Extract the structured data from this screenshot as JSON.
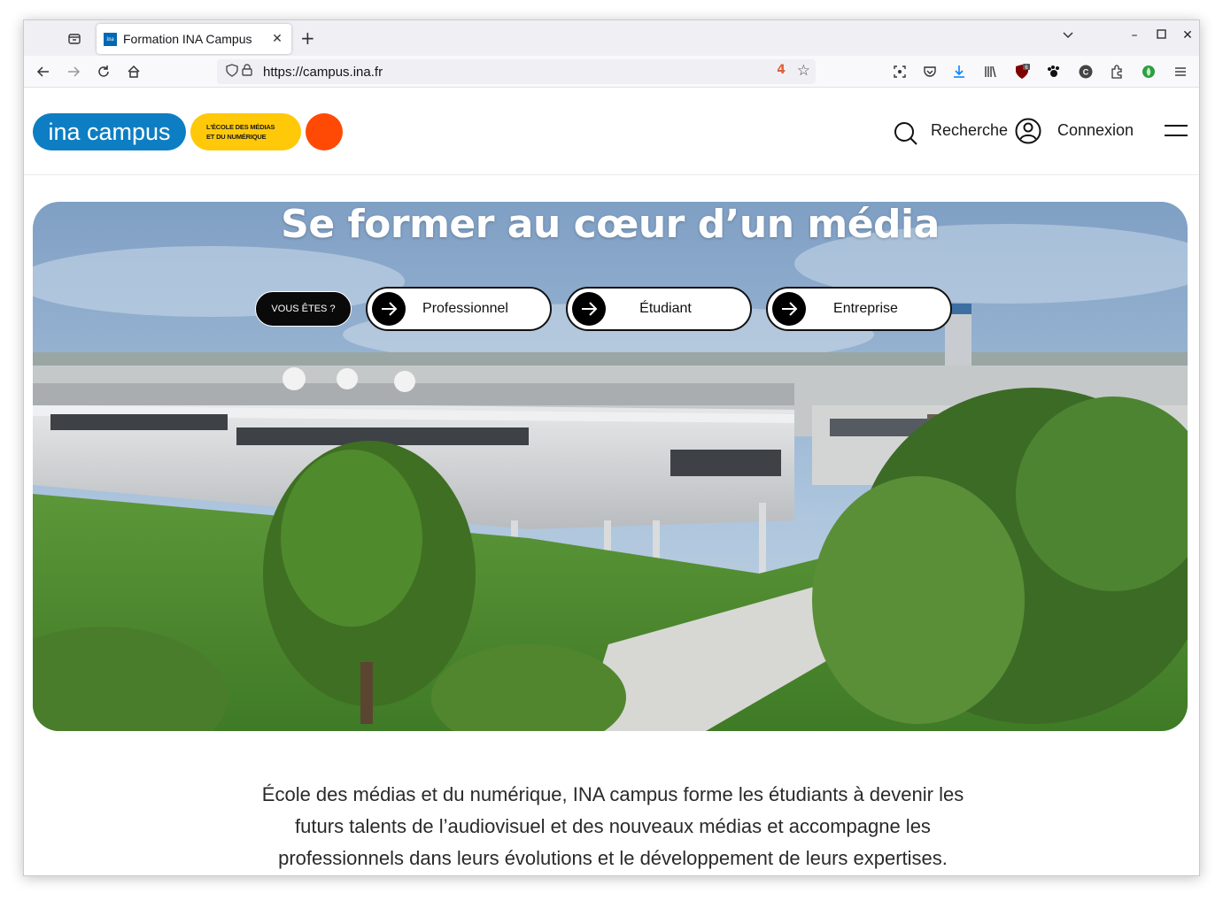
{
  "browser": {
    "tab_title": "Formation INA Campus",
    "favicon_text": "ina",
    "url": "https://campus.ina.fr",
    "permission_badge": "4",
    "extension_badge": "6",
    "extension_c_label": "C"
  },
  "site": {
    "logo_text": "ina campus",
    "tagline_line1": "L'ÉCOLE DES MÉDIAS",
    "tagline_line2": "ET DU NUMÉRIQUE",
    "search_label": "Recherche",
    "login_label": "Connexion"
  },
  "hero": {
    "title": "Se former au cœur d’un média",
    "prompt_label": "VOUS ÊTES ?",
    "choices": [
      {
        "label": "Professionnel"
      },
      {
        "label": "Étudiant"
      },
      {
        "label": "Entreprise"
      }
    ]
  },
  "intro": {
    "line1": "École des médias et du numérique, INA campus forme les étudiants à devenir les",
    "line2": "futurs talents de l’audiovisuel et des nouveaux médias et accompagne les",
    "line3": "professionnels dans leurs évolutions et le développement de leurs expertises."
  },
  "colors": {
    "brand_blue": "#0d7ec3",
    "brand_yellow": "#ffc90a",
    "brand_orange": "#ff4a05"
  }
}
